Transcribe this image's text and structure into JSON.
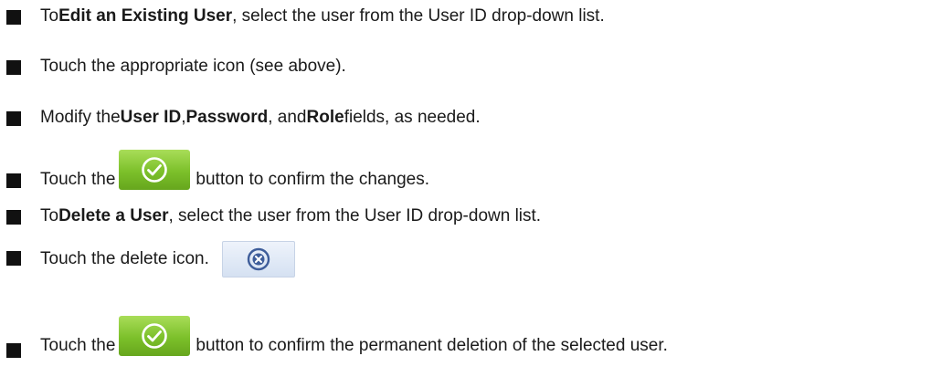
{
  "steps": [
    {
      "pre": "To ",
      "bold": "Edit an Existing User",
      "post": ", select the user from the User ID drop-down list."
    },
    {
      "text": "Touch the appropriate icon (see above)."
    },
    {
      "pre": "Modify the ",
      "b1": "User ID",
      "m1": ", ",
      "b2": "Password",
      "m2": ", and ",
      "b3": "Role",
      "post": " fields, as needed."
    },
    {
      "pre": "Touch the",
      "post": "button to confirm the changes."
    },
    {
      "pre": "To ",
      "bold": "Delete a User",
      "post": ", select the user from the User ID drop-down list."
    },
    {
      "text": "Touch the delete icon."
    },
    {
      "pre": "Touch the",
      "post": "button to confirm the permanent deletion of the selected user."
    }
  ],
  "icons": {
    "confirm": "check-circle-icon",
    "delete": "x-circle-icon",
    "bullet": "square-bullet"
  },
  "colors": {
    "confirm_green": "#7cc02a",
    "delete_blue": "#3e5d9a"
  }
}
